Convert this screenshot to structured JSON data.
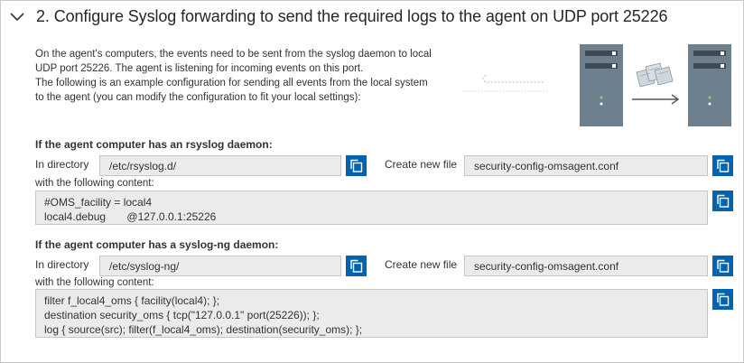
{
  "header": {
    "title": "2. Configure Syslog forwarding to send the required logs to the agent on UDP port 25226",
    "collapse_icon": "chevron-down-icon"
  },
  "description": [
    "On the agent's computers, the events need to be sent from the syslog daemon to local",
    "UDP port 25226. The agent is listening for incoming events on this port.",
    "The following is an example configuration for sending all events from the local system",
    "to the agent (you can modify the configuration to fit your local settings):"
  ],
  "rsyslog": {
    "heading": "If the agent computer has an rsyslog daemon:",
    "dir_label": "In directory",
    "dir_value": "/etc/rsyslog.d/",
    "file_label": "Create new file",
    "file_value": "security-config-omsagent.conf",
    "content_label": "with the following content:",
    "content_lines": [
      "#OMS_facility = local4",
      "local4.debug       @127.0.0.1:25226"
    ]
  },
  "syslogng": {
    "heading": "If the agent computer has a syslog-ng daemon:",
    "dir_label": "In directory",
    "dir_value": "/etc/syslog-ng/",
    "file_label": "Create new file",
    "file_value": "security-config-omsagent.conf",
    "content_label": "with the following content:",
    "content_lines": [
      "filter f_local4_oms { facility(local4); };",
      "destination security_oms { tcp(\"127.0.0.1\" port(25226)); };",
      "log { source(src); filter(f_local4_oms); destination(security_oms); };"
    ]
  },
  "icons": {
    "copy": "copy-icon",
    "server": "server-icon",
    "documents": "documents-icon",
    "arrow": "arrow-right-icon"
  },
  "colors": {
    "accent": "#0063b1",
    "field_bg": "#ebebeb",
    "server_body": "#6e7f8e"
  }
}
